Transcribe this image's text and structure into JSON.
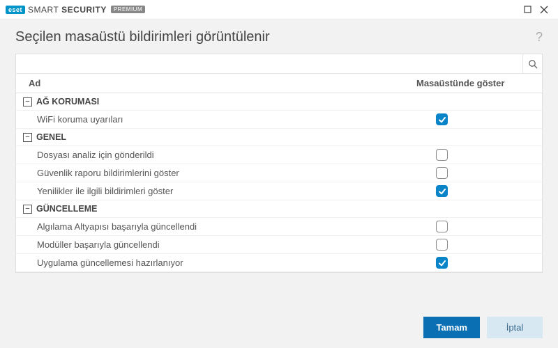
{
  "brand": {
    "logo": "eset",
    "text_light": "SMART",
    "text_bold": "SECURITY",
    "badge": "PREMIUM"
  },
  "heading": "Seçilen masaüstü bildirimleri görüntülenir",
  "search": {
    "placeholder": ""
  },
  "columns": {
    "name": "Ad",
    "show": "Masaüstünde göster"
  },
  "groups": [
    {
      "label": "AĞ KORUMASI",
      "expanded": true,
      "items": [
        {
          "name": "WiFi koruma uyarıları",
          "checked": true
        }
      ]
    },
    {
      "label": "GENEL",
      "expanded": true,
      "items": [
        {
          "name": "Dosyası analiz için gönderildi",
          "checked": false
        },
        {
          "name": "Güvenlik raporu bildirimlerini göster",
          "checked": false
        },
        {
          "name": "Yenilikler ile ilgili bildirimleri göster",
          "checked": true
        }
      ]
    },
    {
      "label": "GÜNCELLEME",
      "expanded": true,
      "items": [
        {
          "name": "Algılama Altyapısı başarıyla güncellendi",
          "checked": false
        },
        {
          "name": "Modüller başarıyla güncellendi",
          "checked": false
        },
        {
          "name": "Uygulama güncellemesi hazırlanıyor",
          "checked": true
        }
      ]
    }
  ],
  "buttons": {
    "ok": "Tamam",
    "cancel": "İptal"
  }
}
